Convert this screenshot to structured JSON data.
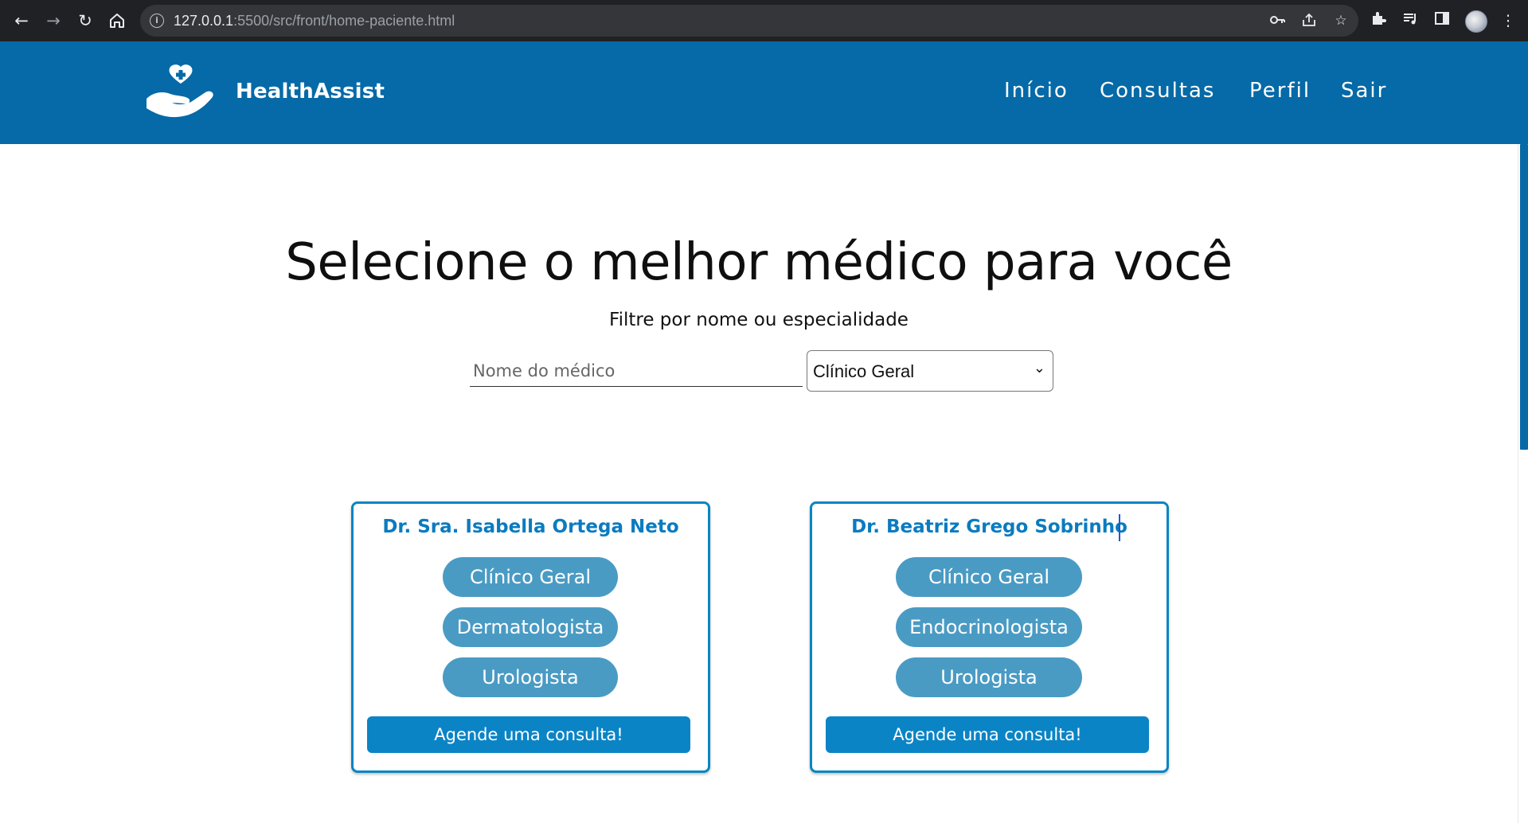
{
  "browser": {
    "url_host": "127.0.0.1",
    "url_rest": ":5500/src/front/home-paciente.html",
    "icons": [
      "back-arrow-icon",
      "forward-arrow-icon",
      "reload-icon",
      "home-icon",
      "site-info-icon",
      "key-icon",
      "share-icon",
      "star-icon",
      "extensions-icon",
      "media-queue-icon",
      "side-panel-icon",
      "profile-avatar",
      "more-icon"
    ]
  },
  "header": {
    "brand": "HealthAssist",
    "nav": [
      "Início",
      "Consultas",
      "Perfil",
      "Sair"
    ],
    "colors": {
      "bar": "#056aa7",
      "text": "#ffffff"
    }
  },
  "hero": {
    "title": "Selecione o melhor médico para você",
    "subtitle": "Filtre por nome ou especialidade",
    "name_placeholder": "Nome do médico",
    "specialty_selected": "Clínico Geral"
  },
  "doctors": [
    {
      "name": "Dr. Sra. Isabella Ortega Neto",
      "specialties": [
        "Clínico Geral",
        "Dermatologista",
        "Urologista"
      ],
      "button": "Agende uma consulta!"
    },
    {
      "name": "Dr. Beatriz Grego Sobrinho",
      "specialties": [
        "Clínico Geral",
        "Endocrinologista",
        "Urologista"
      ],
      "button": "Agende uma consulta!"
    }
  ],
  "theme": {
    "accent": "#0b84c6",
    "chip": "#4a9bc4",
    "card_border": "#0a85c2",
    "card_title": "#0b7bbf"
  }
}
